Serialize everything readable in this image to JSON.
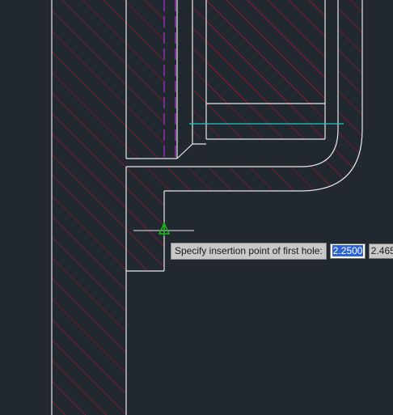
{
  "drawing": {
    "background": "#212830",
    "hatch_color": "#c8102e",
    "outline_color": "#e8e8e8",
    "centerline_color": "#b030d0",
    "dimension_color": "#20c8c8",
    "cursor_color": "#18b818",
    "crosshair_color": "#e8e8e8"
  },
  "dynamic_input": {
    "prompt": "Specify insertion point of first hole:",
    "x_value": "2.2500",
    "y_value": "2.465"
  }
}
